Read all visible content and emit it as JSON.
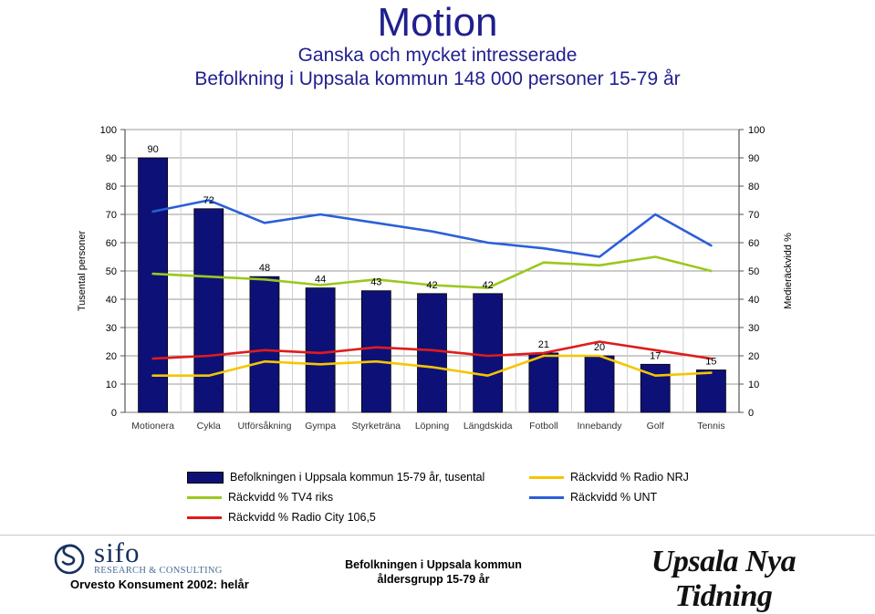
{
  "title": {
    "main": "Motion",
    "subtitle_1": "Ganska och mycket intresserade",
    "subtitle_2": "Befolkning i Uppsala kommun 148 000 personer 15-79 år"
  },
  "chart_data": {
    "type": "bar",
    "title": "Motion",
    "categories": [
      "Motionera",
      "Cykla",
      "Utförsåkning",
      "Gympa",
      "Styrketräna",
      "Löpning",
      "Längdskida",
      "Fotboll",
      "Innebandy",
      "Golf",
      "Tennis"
    ],
    "xlabel": "",
    "ylabel": "Tusental personer",
    "y2label": "Medieräckvidd %",
    "ylim": [
      0,
      100
    ],
    "y2lim": [
      0,
      100
    ],
    "yticks": [
      0,
      10,
      20,
      30,
      40,
      50,
      60,
      70,
      80,
      90,
      100
    ],
    "y2ticks": [
      0,
      10,
      20,
      30,
      40,
      50,
      60,
      70,
      80,
      90,
      100
    ],
    "grid": true,
    "legend_position": "bottom",
    "bar_color": "#0d1177",
    "series": [
      {
        "name": "Befolkningen i Uppsala kommun 15-79 år, tusental",
        "type": "bar",
        "color": "#0d1177",
        "axis": "left",
        "values": [
          90,
          72,
          48,
          44,
          43,
          42,
          42,
          21,
          20,
          17,
          15
        ],
        "labels": [
          "90",
          "72",
          "48",
          "44",
          "43",
          "42",
          "42",
          "21",
          "20",
          "17",
          "15"
        ]
      },
      {
        "name": "Räckvidd % TV4 riks",
        "type": "line",
        "color": "#9ac81e",
        "axis": "right",
        "values": [
          49,
          48,
          47,
          45,
          47,
          45,
          44,
          53,
          52,
          55,
          50
        ]
      },
      {
        "name": "Räckvidd % Radio City 106,5",
        "type": "line",
        "color": "#e01b1b",
        "axis": "right",
        "values": [
          19,
          20,
          22,
          21,
          23,
          22,
          20,
          21,
          25,
          22,
          19
        ]
      },
      {
        "name": "Räckvidd % Radio NRJ",
        "type": "line",
        "color": "#f5c500",
        "axis": "right",
        "values": [
          13,
          13,
          18,
          17,
          18,
          16,
          13,
          20,
          20,
          13,
          14
        ]
      },
      {
        "name": "Räckvidd % UNT",
        "type": "line",
        "color": "#2b5fd9",
        "axis": "right",
        "values": [
          71,
          75,
          67,
          70,
          67,
          64,
          60,
          58,
          55,
          70,
          59
        ]
      }
    ]
  },
  "legend": {
    "items": [
      {
        "label": "Befolkningen i Uppsala kommun 15-79 år, tusental",
        "color": "#0d1177",
        "marker": "box"
      },
      {
        "label": "Räckvidd % TV4 riks",
        "color": "#9ac81e",
        "marker": "line"
      },
      {
        "label": "Räckvidd % Radio City 106,5",
        "color": "#e01b1b",
        "marker": "line"
      },
      {
        "label": "Räckvidd % Radio NRJ",
        "color": "#f5c500",
        "marker": "line"
      },
      {
        "label": "Räckvidd % UNT",
        "color": "#2b5fd9",
        "marker": "line"
      }
    ]
  },
  "footer": {
    "sifo_word": "sifo",
    "sifo_sub": "RESEARCH & CONSULTING",
    "orvesto": "Orvesto Konsument 2002: helår",
    "caption_line_1": "Befolkningen i Uppsala kommun",
    "caption_line_2": "åldersgrupp 15-79 år",
    "unt_logo": "Upsala Nya Tidning"
  }
}
